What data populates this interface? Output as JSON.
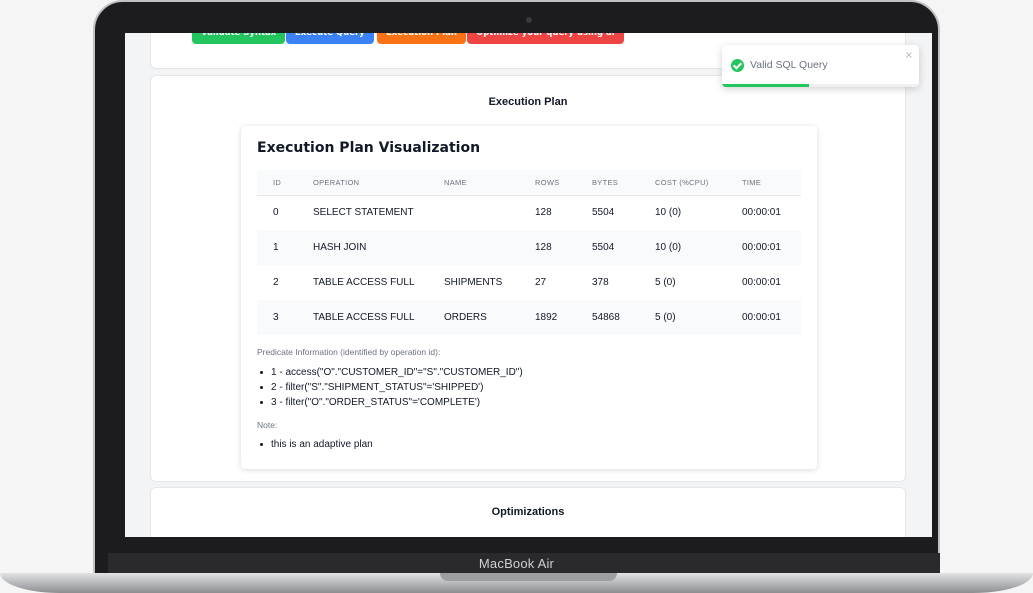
{
  "toolbar": {
    "validate_label": "Validate Syntax",
    "execute_label": "Execute Query",
    "plan_label": "Execution Plan",
    "optimize_label": "Optimize your query using ai"
  },
  "plan_section": {
    "title": "Execution Plan",
    "viz_title": "Execution Plan Visualization",
    "columns": [
      "ID",
      "OPERATION",
      "NAME",
      "ROWS",
      "BYTES",
      "COST (%CPU)",
      "TIME"
    ],
    "rows": [
      [
        "0",
        "SELECT STATEMENT",
        "",
        "128",
        "5504",
        "10 (0)",
        "00:00:01"
      ],
      [
        "1",
        "HASH JOIN",
        "",
        "128",
        "5504",
        "10 (0)",
        "00:00:01"
      ],
      [
        "2",
        "TABLE ACCESS FULL",
        "SHIPMENTS",
        "27",
        "378",
        "5 (0)",
        "00:00:01"
      ],
      [
        "3",
        "TABLE ACCESS FULL",
        "ORDERS",
        "1892",
        "54868",
        "5 (0)",
        "00:00:01"
      ]
    ],
    "predicate_label": "Predicate Information (identified by operation id):",
    "predicates": [
      "1 - access(\"O\".\"CUSTOMER_ID\"=\"S\".\"CUSTOMER_ID\")",
      "2 - filter(\"S\".\"SHIPMENT_STATUS\"='SHIPPED')",
      "3 - filter(\"O\".\"ORDER_STATUS\"='COMPLETE')"
    ],
    "note_label": "Note:",
    "notes": [
      "this is an adaptive plan"
    ]
  },
  "optimizations": {
    "title": "Optimizations"
  },
  "toast": {
    "message": "Valid SQL Query",
    "close_glyph": "×",
    "progress": 0.44
  },
  "device": {
    "label": "MacBook Air"
  },
  "colors": {
    "validate": "#22c55e",
    "execute": "#3b82f6",
    "plan": "#f97316",
    "optimize": "#ef4444",
    "success": "#22c55e"
  },
  "icons": {
    "toast": "check-circle-icon",
    "close": "close-icon"
  }
}
